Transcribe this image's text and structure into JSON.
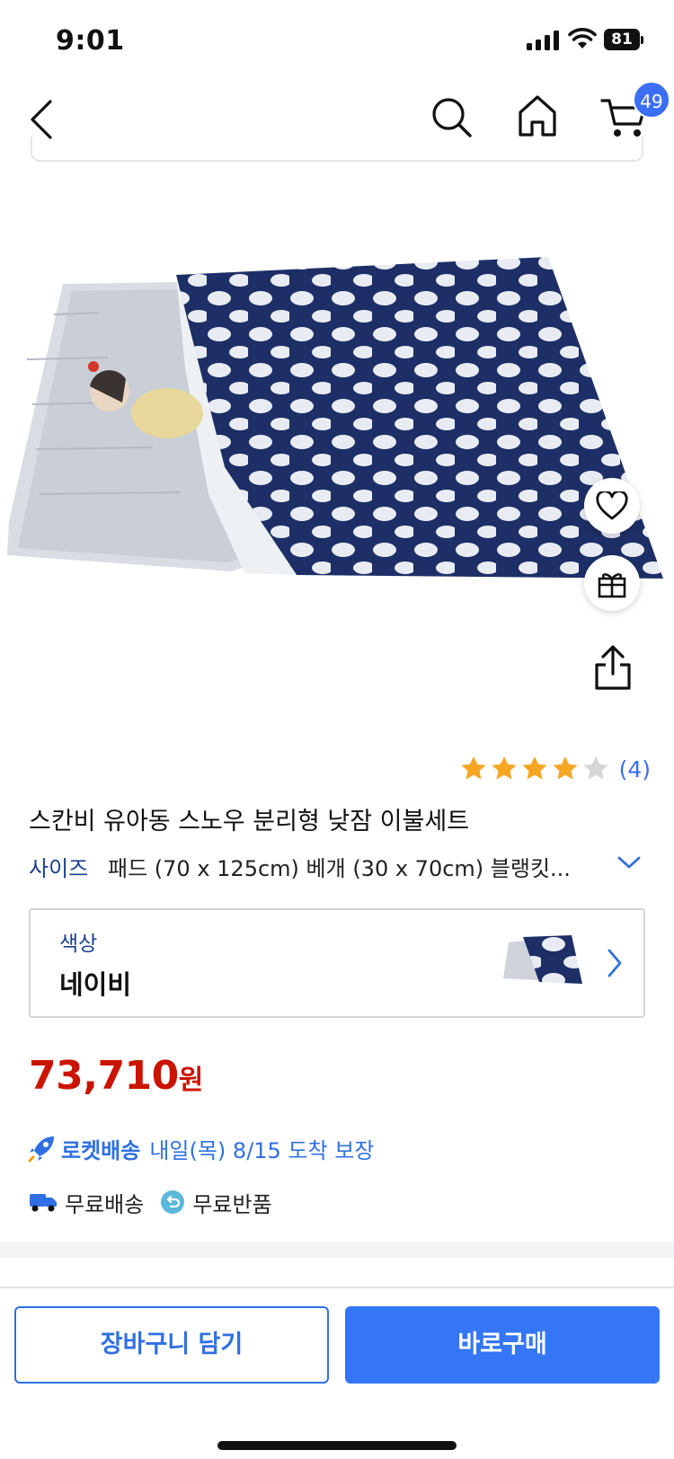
{
  "status_bar": {
    "time": "9:01",
    "battery": "81"
  },
  "nav": {
    "cart_count": "49"
  },
  "product": {
    "rating": 4,
    "rating_max": 5,
    "review_count": "(4)",
    "title": "스칸비 유아동 스노우 분리형 낮잠 이불세트",
    "size_label": "사이즈",
    "size_value": "패드 (70 x 125cm) 베개 (30 x 70cm) 블랭킷...",
    "color_label": "색상",
    "color_value": "네이비",
    "price_number": "73,710",
    "price_unit": "원"
  },
  "delivery": {
    "brand": "로켓배송",
    "text": "내일(목) 8/15 도착 보장",
    "free_shipping": "무료배송",
    "free_return": "무료반품"
  },
  "actions": {
    "add_to_cart": "장바구니 담기",
    "buy_now": "바로구매"
  },
  "colors": {
    "accent": "#3476f5",
    "price": "#cb1400",
    "star": "#f5a623",
    "navy": "#1d2f66"
  },
  "icons": [
    "back-icon",
    "search-icon",
    "home-icon",
    "cart-icon",
    "heart-icon",
    "gift-icon",
    "share-icon",
    "chevron-down-icon",
    "chevron-right-icon",
    "rocket-icon",
    "truck-icon",
    "return-icon"
  ]
}
